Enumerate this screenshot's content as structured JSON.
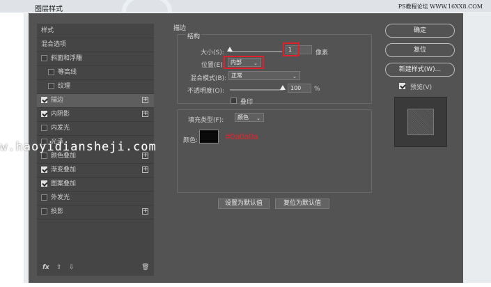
{
  "window": {
    "title": "图层样式",
    "site_mark": "PS教程论坛 WWW.16XX8.COM"
  },
  "left_panel": {
    "items": [
      {
        "label": "样式",
        "checkbox": false,
        "checked": false,
        "plus": false,
        "indent": 0
      },
      {
        "label": "混合选项",
        "checkbox": false,
        "checked": false,
        "plus": false,
        "indent": 0
      },
      {
        "label": "斜面和浮雕",
        "checkbox": true,
        "checked": false,
        "plus": false,
        "indent": 0
      },
      {
        "label": "等高线",
        "checkbox": true,
        "checked": false,
        "plus": false,
        "indent": 1
      },
      {
        "label": "纹理",
        "checkbox": true,
        "checked": false,
        "plus": false,
        "indent": 1
      },
      {
        "label": "描边",
        "checkbox": true,
        "checked": true,
        "plus": true,
        "indent": 0,
        "selected": true
      },
      {
        "label": "内阴影",
        "checkbox": true,
        "checked": true,
        "plus": true,
        "indent": 0
      },
      {
        "label": "内发光",
        "checkbox": true,
        "checked": false,
        "plus": false,
        "indent": 0
      },
      {
        "label": "光泽",
        "checkbox": true,
        "checked": false,
        "plus": false,
        "indent": 0
      },
      {
        "label": "颜色叠加",
        "checkbox": true,
        "checked": false,
        "plus": true,
        "indent": 0
      },
      {
        "label": "渐变叠加",
        "checkbox": true,
        "checked": true,
        "plus": true,
        "indent": 0
      },
      {
        "label": "图案叠加",
        "checkbox": true,
        "checked": true,
        "plus": false,
        "indent": 0
      },
      {
        "label": "外发光",
        "checkbox": true,
        "checked": false,
        "plus": false,
        "indent": 0
      },
      {
        "label": "投影",
        "checkbox": true,
        "checked": false,
        "plus": true,
        "indent": 0
      }
    ],
    "footer": {
      "fx": "fx",
      "up": "⇧",
      "down": "⇩",
      "trash": "🗑"
    }
  },
  "stroke": {
    "title": "描边",
    "structure_label": "结构",
    "size_label": "大小(S):",
    "size_value": "1",
    "size_unit": "像素",
    "position_label": "位置(E):",
    "position_value": "内部",
    "blend_label": "混合模式(B):",
    "blend_value": "正常",
    "opacity_label": "不透明度(O):",
    "opacity_value": "100",
    "opacity_unit": "%",
    "overprint_label": "叠印",
    "fill_type_label": "填充类型(F):",
    "fill_type_value": "颜色",
    "color_label": "颜色:",
    "color_hex_annotation": "#0a0a0a",
    "set_default": "设置为默认值",
    "reset_default": "复位为默认值"
  },
  "watermark": "w.haoyidiansheji.com",
  "right_panel": {
    "ok": "确定",
    "reset": "复位",
    "new_style": "新建样式(W)...",
    "preview_label": "预览(V)",
    "preview_checked": true
  },
  "colors": {
    "dialog_bg": "#535353",
    "accent_red": "#e8232b",
    "swatch": "#0a0a0a"
  }
}
